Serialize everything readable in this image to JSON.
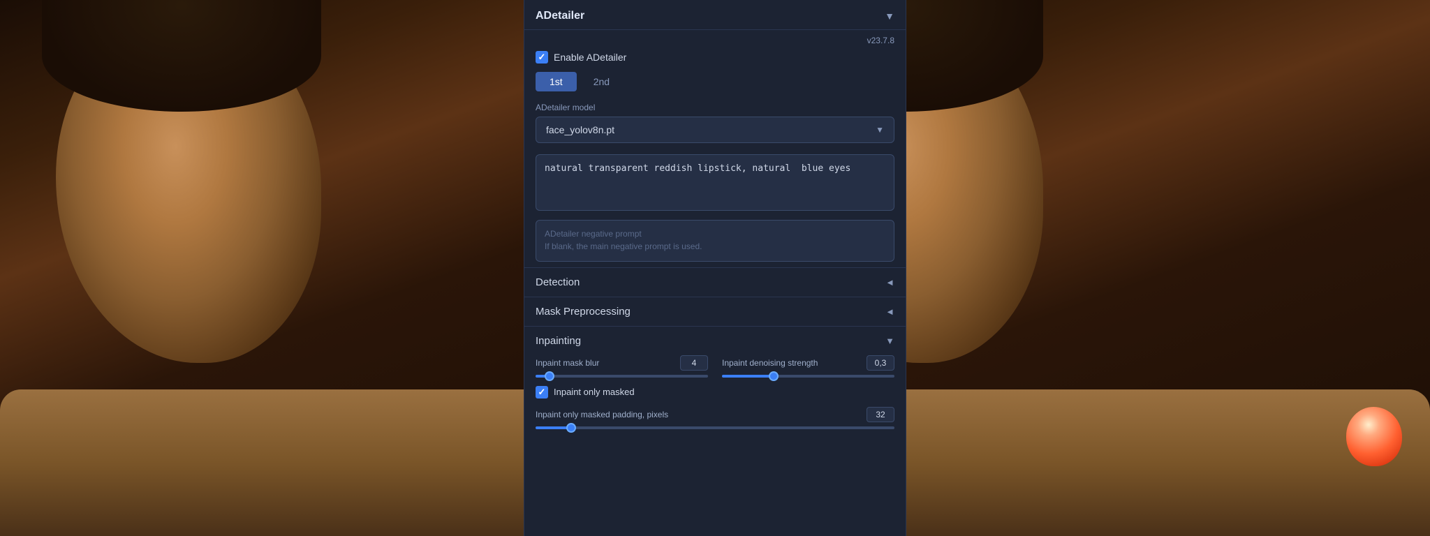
{
  "panel": {
    "title": "ADetailer",
    "version": "v23.7.8",
    "collapse_icon": "▼",
    "enable_label": "Enable ADetailer",
    "tabs": [
      {
        "label": "1st",
        "active": true
      },
      {
        "label": "2nd",
        "active": false
      }
    ],
    "model_section": {
      "label": "ADetailer model",
      "selected": "face_yolov8n.pt"
    },
    "prompt": {
      "value": "natural transparent reddish lipstick, natural  blue eyes",
      "placeholder_line1": "ADetailer negative prompt",
      "placeholder_line2": "If blank, the main negative prompt is used."
    },
    "detection": {
      "title": "Detection",
      "arrow": "◄"
    },
    "mask_preprocessing": {
      "title": "Mask Preprocessing",
      "arrow": "◄"
    },
    "inpainting": {
      "title": "Inpainting",
      "arrow": "▼",
      "mask_blur_label": "Inpaint mask blur",
      "mask_blur_value": "4",
      "mask_blur_percent": 8,
      "denoise_label": "Inpaint denoising strength",
      "denoise_value": "0,3",
      "denoise_percent": 30,
      "only_masked_label": "Inpaint only masked",
      "only_masked_checked": true,
      "padding_label": "Inpaint only masked padding, pixels",
      "padding_value": "32",
      "padding_percent": 10
    }
  }
}
